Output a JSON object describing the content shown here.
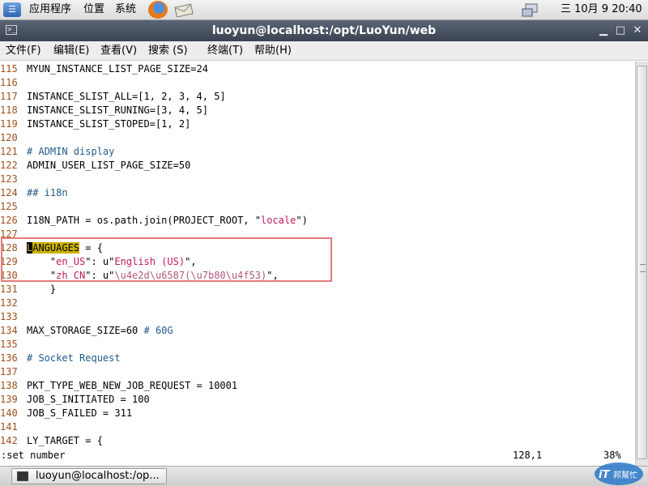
{
  "top_panel": {
    "apps_menu": "应用程序",
    "places_menu": "位置",
    "system_menu": "系统",
    "clock": "三 10月  9 20:40",
    "icons": [
      "app-logo-icon",
      "firefox-icon",
      "mail-icon",
      "network-icon"
    ]
  },
  "window": {
    "title": "luoyun@localhost:/opt/LuoYun/web",
    "buttons": [
      "minimize",
      "maximize",
      "close"
    ]
  },
  "menu": {
    "file": "文件(F)",
    "edit": "编辑(E)",
    "view": "查看(V)",
    "search": "搜索 (S)",
    "terminal": "终端(T)",
    "help": "帮助(H)"
  },
  "editor": {
    "lines": [
      {
        "n": "115",
        "parts": [
          [
            "code",
            "MYUN_INSTANCE_LIST_PAGE_SIZE=24"
          ]
        ]
      },
      {
        "n": "116",
        "parts": []
      },
      {
        "n": "117",
        "parts": [
          [
            "code",
            "INSTANCE_SLIST_ALL=[1, 2, 3, 4, 5]"
          ]
        ]
      },
      {
        "n": "118",
        "parts": [
          [
            "code",
            "INSTANCE_SLIST_RUNING=[3, 4, 5]"
          ]
        ]
      },
      {
        "n": "119",
        "parts": [
          [
            "code",
            "INSTANCE_SLIST_STOPED=[1, 2]"
          ]
        ]
      },
      {
        "n": "120",
        "parts": []
      },
      {
        "n": "121",
        "parts": [
          [
            "cmt",
            "# ADMIN display"
          ]
        ]
      },
      {
        "n": "122",
        "parts": [
          [
            "code",
            "ADMIN_USER_LIST_PAGE_SIZE=50"
          ]
        ]
      },
      {
        "n": "123",
        "parts": []
      },
      {
        "n": "124",
        "parts": [
          [
            "cmt",
            "## i18n"
          ]
        ]
      },
      {
        "n": "125",
        "parts": []
      },
      {
        "n": "126",
        "parts": [
          [
            "code",
            "I18N_PATH = os.path.join(PROJECT_ROOT, \""
          ],
          [
            "str",
            "locale"
          ],
          [
            "code",
            "\")"
          ]
        ]
      },
      {
        "n": "127",
        "parts": []
      },
      {
        "n": "128",
        "parts": [
          [
            "cursor",
            "L"
          ],
          [
            "hl",
            "ANGUAGES"
          ],
          [
            "code",
            " = {"
          ]
        ]
      },
      {
        "n": "129",
        "parts": [
          [
            "code",
            "    \""
          ],
          [
            "str",
            "en_US"
          ],
          [
            "code",
            "\": u\""
          ],
          [
            "str",
            "English (US)"
          ],
          [
            "code",
            "\","
          ]
        ]
      },
      {
        "n": "130",
        "parts": [
          [
            "code",
            "    \""
          ],
          [
            "str",
            "zh_CN"
          ],
          [
            "code",
            "\": u\""
          ],
          [
            "esc",
            "\\u4e2d\\u6587(\\u7b80\\u4f53)"
          ],
          [
            "code",
            "\","
          ]
        ]
      },
      {
        "n": "131",
        "parts": [
          [
            "code",
            "    }"
          ]
        ]
      },
      {
        "n": "132",
        "parts": []
      },
      {
        "n": "133",
        "parts": []
      },
      {
        "n": "134",
        "parts": [
          [
            "code",
            "MAX_STORAGE_SIZE=60 "
          ],
          [
            "cmt",
            "# 60G"
          ]
        ]
      },
      {
        "n": "135",
        "parts": []
      },
      {
        "n": "136",
        "parts": [
          [
            "cmt",
            "# Socket Request"
          ]
        ]
      },
      {
        "n": "137",
        "parts": []
      },
      {
        "n": "138",
        "parts": [
          [
            "code",
            "PKT_TYPE_WEB_NEW_JOB_REQUEST = 10001"
          ]
        ]
      },
      {
        "n": "139",
        "parts": [
          [
            "code",
            "JOB_S_INITIATED = 100"
          ]
        ]
      },
      {
        "n": "140",
        "parts": [
          [
            "code",
            "JOB_S_FAILED = 311"
          ]
        ]
      },
      {
        "n": "141",
        "parts": []
      },
      {
        "n": "142",
        "parts": [
          [
            "code",
            "LY_TARGET = {"
          ]
        ]
      }
    ]
  },
  "status": {
    "command": ":set number",
    "position": "128,1",
    "percent": "38%"
  },
  "taskbar": {
    "task_label": "luoyun@localhost:/op..."
  },
  "watermark": {
    "text": "iT邦幫忙"
  }
}
